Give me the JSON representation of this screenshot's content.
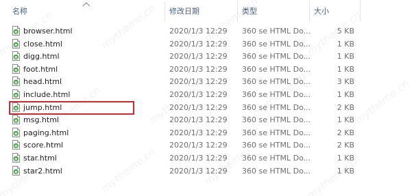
{
  "columns": {
    "name": "名称",
    "date": "修改日期",
    "type": "类型",
    "size": "大小"
  },
  "sort": {
    "column": "name",
    "direction": "ascending",
    "icon": "sort-up-icon"
  },
  "file_icon": "html-document-icon",
  "highlight_color": "#d7262e",
  "watermark": "mytheme.cn",
  "files": [
    {
      "name": "browser.html",
      "modified": "2020/1/3 12:29",
      "type": "360 se HTML Do...",
      "size": "5 KB"
    },
    {
      "name": "close.html",
      "modified": "2020/1/3 12:29",
      "type": "360 se HTML Do...",
      "size": "1 KB"
    },
    {
      "name": "digg.html",
      "modified": "2020/1/3 12:29",
      "type": "360 se HTML Do...",
      "size": "1 KB"
    },
    {
      "name": "foot.html",
      "modified": "2020/1/3 12:29",
      "type": "360 se HTML Do...",
      "size": "1 KB"
    },
    {
      "name": "head.html",
      "modified": "2020/1/3 12:29",
      "type": "360 se HTML Do...",
      "size": "3 KB"
    },
    {
      "name": "include.html",
      "modified": "2020/1/3 12:29",
      "type": "360 se HTML Do...",
      "size": "1 KB"
    },
    {
      "name": "jump.html",
      "modified": "2020/1/3 12:29",
      "type": "360 se HTML Do...",
      "size": "2 KB",
      "highlighted": true
    },
    {
      "name": "msg.html",
      "modified": "2020/1/3 12:29",
      "type": "360 se HTML Do...",
      "size": "1 KB"
    },
    {
      "name": "paging.html",
      "modified": "2020/1/3 12:29",
      "type": "360 se HTML Do...",
      "size": "2 KB"
    },
    {
      "name": "score.html",
      "modified": "2020/1/3 12:29",
      "type": "360 se HTML Do...",
      "size": "2 KB"
    },
    {
      "name": "star.html",
      "modified": "2020/1/3 12:29",
      "type": "360 se HTML Do...",
      "size": "1 KB"
    },
    {
      "name": "star2.html",
      "modified": "2020/1/3 12:29",
      "type": "360 se HTML Do...",
      "size": "1 KB"
    }
  ]
}
